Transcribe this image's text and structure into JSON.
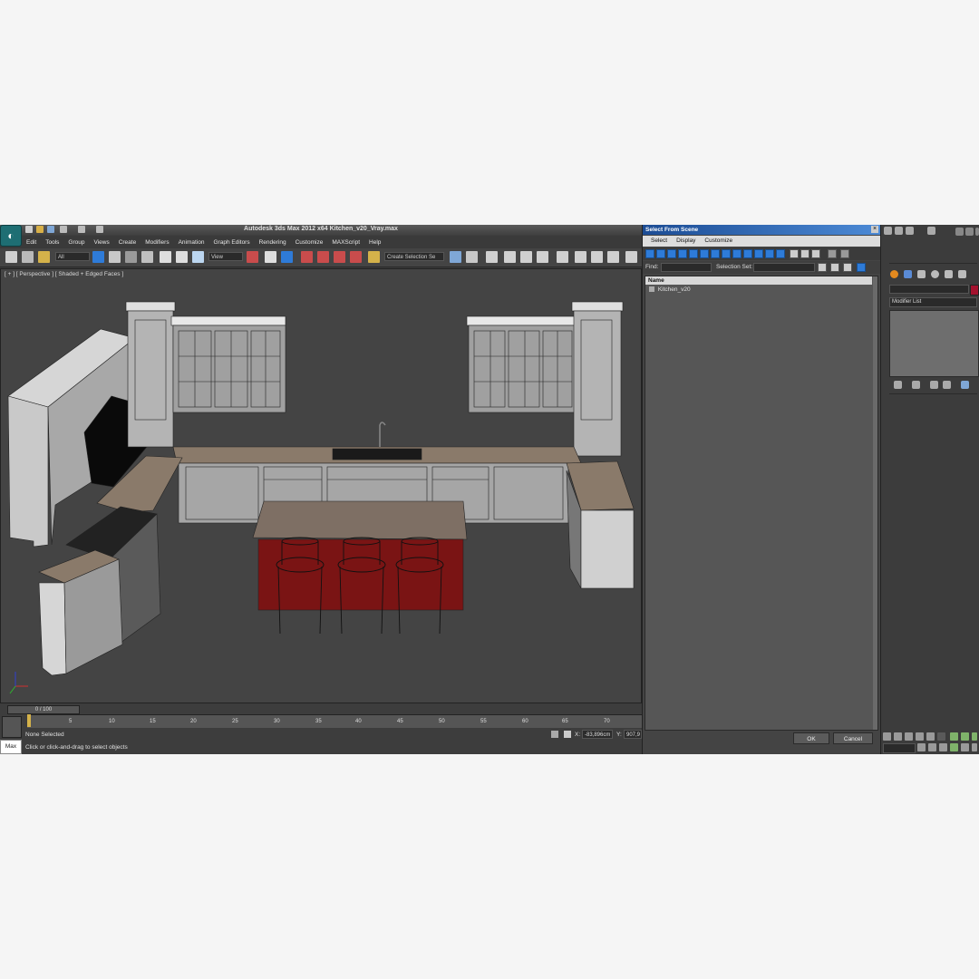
{
  "app": {
    "title": "Autodesk 3ds Max  2012 x64    Kitchen_v20_Vray.max",
    "logo_glyph": "◐",
    "menu": [
      "Edit",
      "Tools",
      "Group",
      "Views",
      "Create",
      "Modifiers",
      "Animation",
      "Graph Editors",
      "Rendering",
      "Customize",
      "MAXScript",
      "Help"
    ]
  },
  "toolbar": {
    "filter_value": "All",
    "view_value": "View",
    "selection_set_placeholder": "Create Selection Se"
  },
  "viewport": {
    "label": "[ + ] [ Perspective ] [ Shaded + Edged Faces ]"
  },
  "timeline": {
    "slider_label": "0 / 100",
    "ticks": [
      "0",
      "5",
      "10",
      "15",
      "20",
      "25",
      "30",
      "35",
      "40",
      "45",
      "50",
      "55",
      "60",
      "65",
      "70"
    ]
  },
  "status": {
    "selection": "None Selected",
    "prompt": "Click or click-and-drag to select objects",
    "max_logo": "Max",
    "x_label": "X:",
    "x_value": "-83,896cm",
    "y_label": "Y:",
    "y_value": "907,9"
  },
  "dialog": {
    "title": "Select From Scene",
    "close_glyph": "×",
    "menu": [
      "Select",
      "Display",
      "Customize"
    ],
    "find_label": "Find:",
    "selection_set_label": "Selection Set:",
    "column_name": "Name",
    "items": [
      "Kitchen_v20"
    ],
    "ok_label": "OK",
    "cancel_label": "Cancel"
  },
  "command_panel": {
    "modifier_list": "Modifier List"
  },
  "colors": {
    "accent_blue": "#2e7bd8",
    "object_color": "#a3122e",
    "viewport_bg": "#444444"
  }
}
